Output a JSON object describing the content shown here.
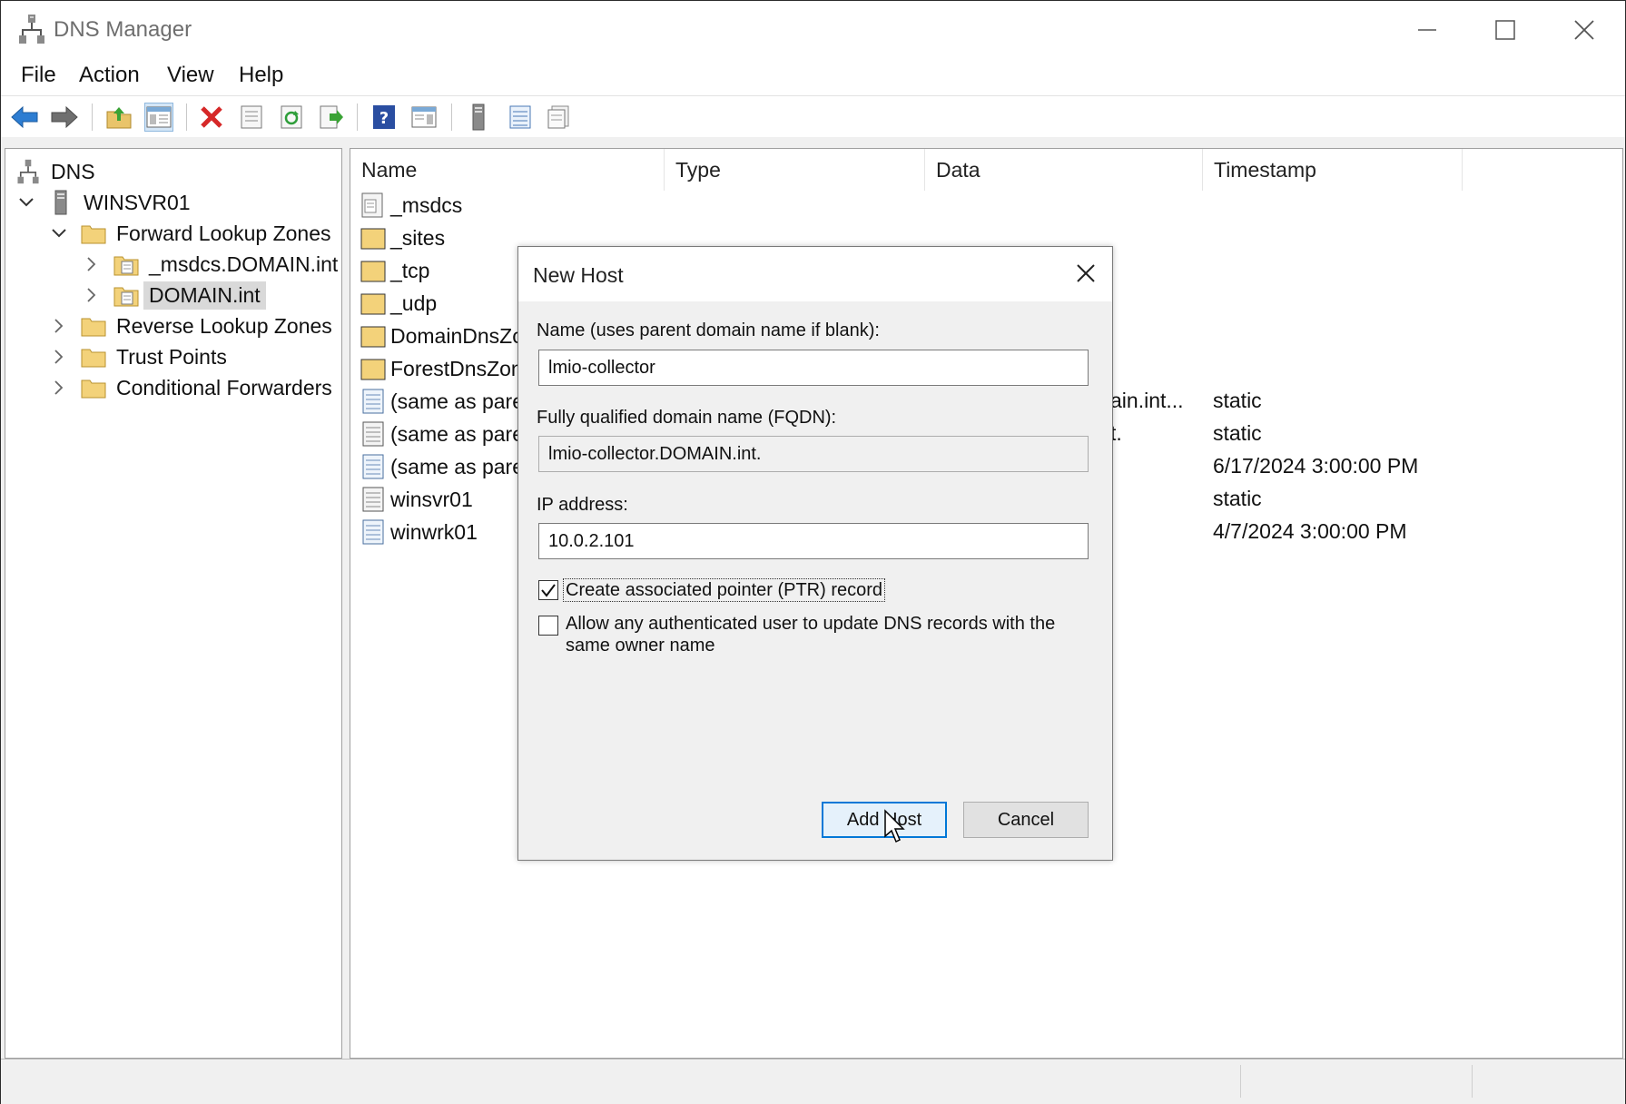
{
  "window": {
    "title": "DNS Manager",
    "controls": {
      "minimize": "minimize-icon",
      "maximize": "maximize-icon",
      "close": "close-icon"
    }
  },
  "menu": [
    "File",
    "Action",
    "View",
    "Help"
  ],
  "toolbar": {
    "icons": [
      "back-arrow-icon",
      "forward-arrow-icon",
      "up-folder-icon",
      "show-hide-console-tree-icon",
      "delete-icon",
      "properties-icon",
      "refresh-icon",
      "export-list-icon",
      "help-icon",
      "show-action-pane-icon",
      "server-icon",
      "list-icon",
      "clipboard-icon"
    ]
  },
  "tree": {
    "root": "DNS",
    "server": "WINSVR01",
    "forward_zones": "Forward Lookup Zones",
    "zone_msdcs": "_msdcs.DOMAIN.int",
    "zone_domain": "DOMAIN.int",
    "reverse_zones": "Reverse Lookup Zones",
    "trust_points": "Trust Points",
    "conditional_forwarders": "Conditional Forwarders"
  },
  "list": {
    "columns": [
      "Name",
      "Type",
      "Data",
      "Timestamp"
    ],
    "rows": [
      {
        "name": "_msdcs",
        "icon": "delegation-icon",
        "data_fragment": "",
        "timestamp": ""
      },
      {
        "name": "_sites",
        "icon": "folder-icon",
        "data_fragment": "",
        "timestamp": ""
      },
      {
        "name": "_tcp",
        "icon": "folder-icon",
        "data_fragment": "",
        "timestamp": ""
      },
      {
        "name": "_udp",
        "icon": "folder-icon",
        "data_fragment": "",
        "timestamp": ""
      },
      {
        "name": "DomainDnsZc",
        "icon": "folder-icon",
        "data_fragment": "",
        "timestamp": ""
      },
      {
        "name": "ForestDnsZon",
        "icon": "folder-icon",
        "data_fragment": "",
        "timestamp": ""
      },
      {
        "name": "(same as pare",
        "icon": "record-icon",
        "data_fragment": "ain.int...",
        "timestamp": "static"
      },
      {
        "name": "(same as pare",
        "icon": "record-icon",
        "data_fragment": "t.",
        "timestamp": "static"
      },
      {
        "name": "(same as pare",
        "icon": "record-icon",
        "data_fragment": "",
        "timestamp": "6/17/2024 3:00:00 PM"
      },
      {
        "name": "winsvr01",
        "icon": "record-icon",
        "data_fragment": "",
        "timestamp": "static"
      },
      {
        "name": "winwrk01",
        "icon": "record-icon",
        "data_fragment": "",
        "timestamp": "4/7/2024 3:00:00 PM"
      }
    ]
  },
  "dialog": {
    "title": "New Host",
    "name_label": "Name (uses parent domain name if blank):",
    "name_value": "lmio-collector",
    "fqdn_label": "Fully qualified domain name (FQDN):",
    "fqdn_value": "lmio-collector.DOMAIN.int.",
    "ip_label": "IP address:",
    "ip_value": "10.0.2.101",
    "ptr_label": "Create associated pointer (PTR) record",
    "ptr_checked": true,
    "auth_label_line1": "Allow any authenticated user to update DNS records with the",
    "auth_label_line2": "same owner name",
    "auth_checked": false,
    "add_button": "Add Host",
    "cancel_button": "Cancel"
  }
}
